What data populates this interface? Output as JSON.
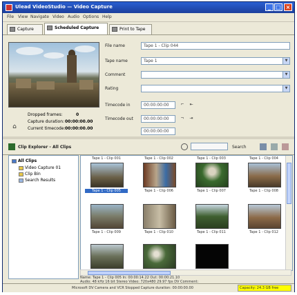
{
  "window": {
    "title": "Ulead VideoStudio — Video Capture"
  },
  "menu": [
    "File",
    "View",
    "Navigate",
    "Video",
    "Audio",
    "Options",
    "Help"
  ],
  "tabs": [
    {
      "label": "Capture",
      "active": false
    },
    {
      "label": "Scheduled Capture",
      "active": true
    },
    {
      "label": "Print to Tape",
      "active": false
    }
  ],
  "form": {
    "file_name_label": "File name",
    "file_name_value": "Tape 1 - Clip 044",
    "tape_name_label": "Tape name",
    "tape_name_value": "Tape 1",
    "comment_label": "Comment",
    "comment_value": "",
    "rating_label": "Rating",
    "rating_value": "",
    "timecode_in_label": "Timecode in",
    "timecode_in_value": "00:00:00:00",
    "timecode_out_label": "Timecode out",
    "timecode_out_value": "00:00:00:00",
    "duration_value": "00:00:00:00"
  },
  "info": {
    "dropped_frames_label": "Dropped frames:",
    "dropped_frames_value": "0",
    "capture_duration_label": "Capture duration:",
    "capture_duration_value": "00:00:00.00",
    "current_timecode_label": "Current timecode:",
    "current_timecode_value": "00:00:00.00"
  },
  "bin": {
    "title": "Clip Explorer - All Clips",
    "search_label": "Search",
    "tree": [
      "All Clips",
      "Video Capture 01",
      "Clip Bin",
      "Search Results"
    ]
  },
  "clips": [
    {
      "top": "Tape 1 - Clip 001",
      "bot": "Tape 1 - Clip 005",
      "selected": true
    },
    {
      "top": "Tape 1 - Clip 002",
      "bot": "Tape 1 - Clip 006",
      "selected": false
    },
    {
      "top": "Tape 1 - Clip 003",
      "bot": "Tape 1 - Clip 007",
      "selected": false
    },
    {
      "top": "Tape 1 - Clip 004",
      "bot": "Tape 1 - Clip 008",
      "selected": false
    },
    {
      "top": "",
      "bot": "Tape 1 - Clip 009",
      "selected": false
    },
    {
      "top": "",
      "bot": "Tape 1 - Clip 010",
      "selected": false
    },
    {
      "top": "",
      "bot": "Tape 1 - Clip 011",
      "selected": false
    },
    {
      "top": "",
      "bot": "Tape 1 - Clip 012",
      "selected": false
    },
    {
      "top": "",
      "bot": "",
      "selected": false
    },
    {
      "top": "",
      "bot": "",
      "selected": false
    },
    {
      "top": "",
      "bot": "",
      "selected": false
    }
  ],
  "details": {
    "line1": "Name: Tape 1 - Clip 005   In: 00:00:14.22   Out: 00:00:21.10",
    "line2": "Audio: 48 kHz 16 bit Stereo   Video: 720x480 29.97 fps DV   Comment:"
  },
  "status": {
    "left": "Microsoft DV Camera and VCR   Stopped   Capture duration: 00:00:00.00",
    "right": "Capacity: 24.3 GB free"
  },
  "colors": {
    "title_bar": "#1c3f9c",
    "selection": "#316ac5",
    "status_highlight": "#ffff00"
  }
}
